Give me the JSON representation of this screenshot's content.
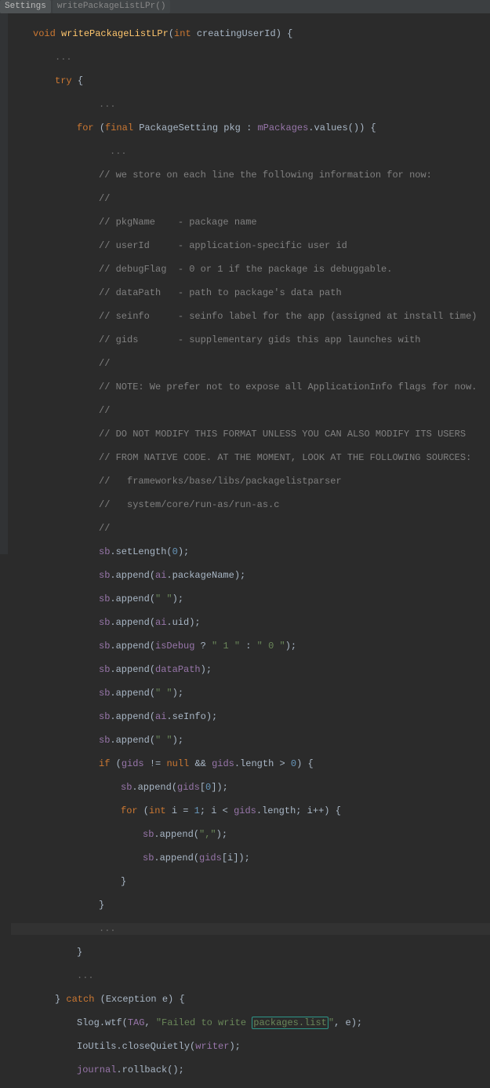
{
  "breadcrumb": {
    "a": "Settings",
    "b": "writePackageListLPr()"
  },
  "sig": {
    "void": "void",
    "name": "writePackageListLPr",
    "int": "int",
    "param": "creatingUserId",
    "open": ") {"
  },
  "fold": "...",
  "try": "try",
  "for1": {
    "for": "for",
    "open": "(",
    "final": "final",
    "type": "PackageSetting",
    "var": "pkg",
    "colon": " : ",
    "field": "mPackages",
    "call": ".values()) {"
  },
  "c1": "// we store on each line the following information for now:",
  "c2": "//",
  "c3": "// pkgName    - package name",
  "c4": "// userId     - application-specific user id",
  "c5": "// debugFlag  - 0 or 1 if the package is debuggable.",
  "c6": "// dataPath   - path to package's data path",
  "c7": "// seinfo     - seinfo label for the app (assigned at install time)",
  "c8": "// gids       - supplementary gids this app launches with",
  "c9": "//",
  "c10": "// NOTE: We prefer not to expose all ApplicationInfo flags for now.",
  "c11": "//",
  "c12": "// DO NOT MODIFY THIS FORMAT UNLESS YOU CAN ALSO MODIFY ITS USERS",
  "c13": "// FROM NATIVE CODE. AT THE MOMENT, LOOK AT THE FOLLOWING SOURCES:",
  "c14": "//   frameworks/base/libs/packagelistparser",
  "c15": "//   system/core/run-as/run-as.c",
  "c16": "//",
  "l1": {
    "sb": "sb",
    "m": ".setLength(",
    "n": "0",
    "e": ");"
  },
  "l2": {
    "sb": "sb",
    "m": ".append(",
    "ai": "ai",
    "f": ".packageName",
    "e": ");"
  },
  "l3": {
    "sb": "sb",
    "m": ".append(",
    "s": "\" \"",
    "e": ");"
  },
  "l4": {
    "sb": "sb",
    "m": ".append(",
    "ai": "ai",
    "f": ".uid",
    "e": ");"
  },
  "l5": {
    "sb": "sb",
    "m": ".append(",
    "id": "isDebug",
    "q": " ? ",
    "s1": "\" 1 \"",
    "col": " : ",
    "s2": "\" 0 \"",
    "e": ");"
  },
  "l6": {
    "sb": "sb",
    "m": ".append(",
    "id": "dataPath",
    "e": ");"
  },
  "l7": {
    "sb": "sb",
    "m": ".append(",
    "s": "\" \"",
    "e": ");"
  },
  "l8": {
    "sb": "sb",
    "m": ".append(",
    "ai": "ai",
    "f": ".seInfo",
    "e": ");"
  },
  "l9": {
    "sb": "sb",
    "m": ".append(",
    "s": "\" \"",
    "e": ");"
  },
  "if": {
    "if": "if",
    "o": " (",
    "g": "gids",
    "ne": " != ",
    "null": "null",
    "and": " && ",
    "g2": "gids",
    "len": ".length > ",
    "n": "0",
    "c": ") {"
  },
  "l10": {
    "sb": "sb",
    "m": ".append(",
    "g": "gids",
    "o": "[",
    "n": "0",
    "c": "]);"
  },
  "for2": {
    "for": "for",
    "o": " (",
    "int": "int",
    "v": " i = ",
    "n1": "1",
    "sc": "; i < ",
    "g": "gids",
    "len": ".length; i++) {"
  },
  "l11": {
    "sb": "sb",
    "m": ".append(",
    "s": "\",\"",
    "e": ");"
  },
  "l12": {
    "sb": "sb",
    "m": ".append(",
    "g": "gids",
    "o": "[i]);"
  },
  "rb": "}",
  "catch": {
    "rb": "} ",
    "catch": "catch",
    "o": " (Exception e) {"
  },
  "slog": {
    "cls": "Slog",
    "m": ".wtf(",
    "tag": "TAG",
    "cm": ", ",
    "s": "\"Failed to write ",
    "box": "packages.list",
    "q": "\"",
    "e": ", e);"
  },
  "io": {
    "cls": "IoUtils",
    "m": ".closeQuietly(",
    "w": "writer",
    "e": ");"
  },
  "jr": {
    "f": "journal",
    "m": ".rollback();"
  }
}
